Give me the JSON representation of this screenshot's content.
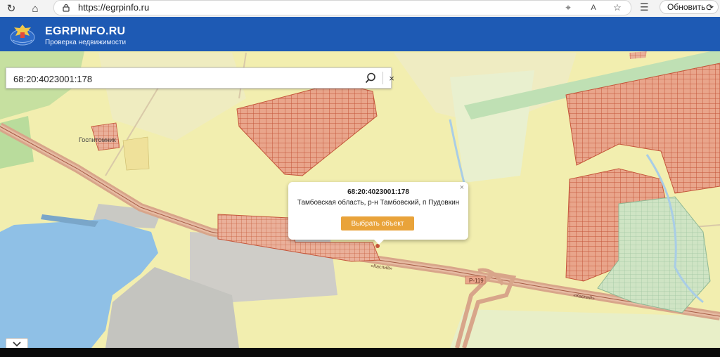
{
  "browser": {
    "url": "https://egrpinfo.ru",
    "refresh_label": "Обновить",
    "icons": [
      "back-icon",
      "refresh-icon",
      "home-icon",
      "lock-icon",
      "location-icon",
      "read-aloud-icon",
      "star-icon",
      "favorites-icon",
      "reload-icon"
    ]
  },
  "header": {
    "title": "EGRPINFO.RU",
    "subtitle": "Проверка недвижимости",
    "color": "#1e5ab4"
  },
  "search": {
    "value": "68:20:4023001:178",
    "icons": [
      "search-icon",
      "close-icon"
    ]
  },
  "popup": {
    "cadastral_number": "68:20:4023001:178",
    "address": "Тамбовская область, р-н Тамбовский, п Пудовкин",
    "select_button": "Выбрать объект",
    "close_symbol": "×"
  },
  "map": {
    "labels": {
      "village": "Госпитомник",
      "route": "Р-119",
      "road1": "«Каспий»",
      "road2": "«Каспий»"
    },
    "colors": {
      "base": "#f2eeaf",
      "parcel": "#e9a58b",
      "parcel_stroke": "#c45a3e",
      "water": "#8fc0e6",
      "road": "#d8a58a"
    }
  },
  "controls": {
    "collapse_icon": "chevron-down-icon"
  }
}
